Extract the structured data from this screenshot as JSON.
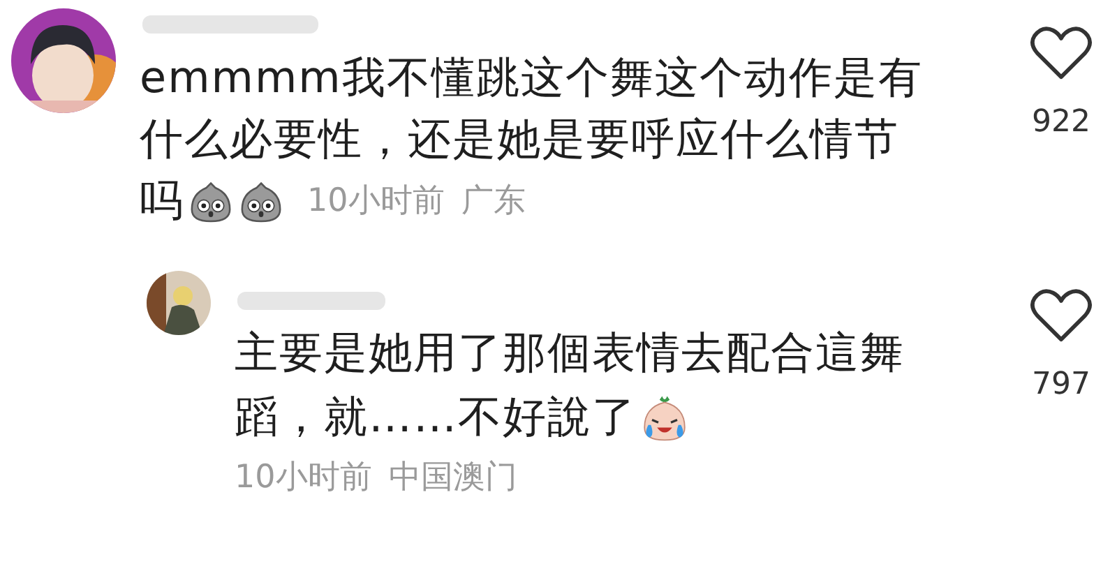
{
  "comments": [
    {
      "text_lines": [
        "emmmm我不懂跳这个舞这个动作是有",
        "什么必要性，还是她是要呼应什么情节",
        "吗"
      ],
      "emojis": [
        {
          "kind": "sack"
        },
        {
          "kind": "sack"
        }
      ],
      "time": "10小时前",
      "location": "广东",
      "likes": "922",
      "liked": false,
      "replies": [
        {
          "text_lines": [
            "主要是她用了那個表情去配合這舞",
            "蹈，就……不好說了"
          ],
          "emojis": [
            {
              "kind": "crying"
            }
          ],
          "time": "10小时前",
          "location": "中国澳门",
          "likes": "797",
          "liked": false
        }
      ]
    }
  ]
}
